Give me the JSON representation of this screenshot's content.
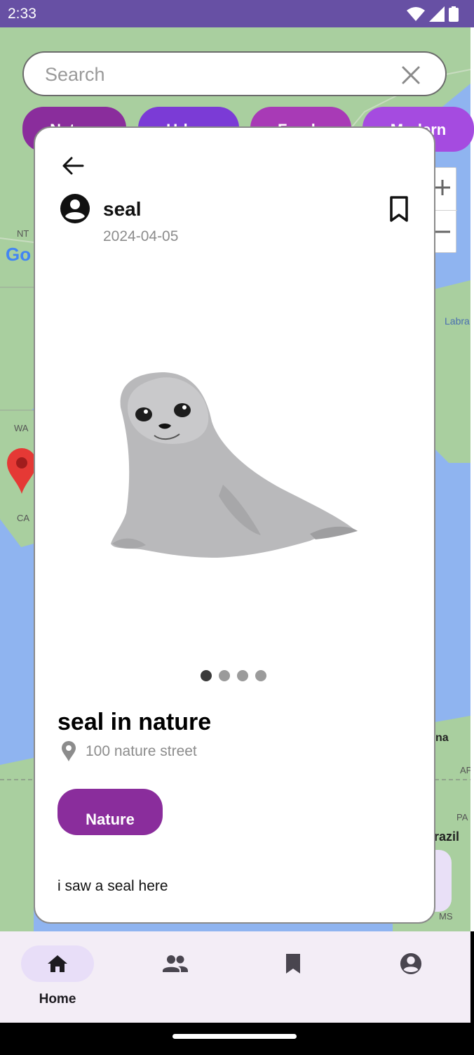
{
  "status_bar": {
    "time": "2:33"
  },
  "search": {
    "placeholder": "Search",
    "value": ""
  },
  "chips": [
    {
      "label": "Nature",
      "color": "#8a2d9c"
    },
    {
      "label": "Urban",
      "color": "#7b3bd6"
    },
    {
      "label": "Foods",
      "color": "#a83ab6"
    },
    {
      "label": "Modern",
      "color": "#a54be0"
    }
  ],
  "map": {
    "labels": [
      "NT",
      "WA",
      "CA",
      "Labra",
      "na",
      "AP",
      "PA",
      "razil",
      "MS"
    ],
    "google_logo": "Go"
  },
  "post": {
    "user_name": "seal",
    "date": "2024-04-05",
    "title": "seal in nature",
    "address": "100 nature street",
    "tag": "Nature",
    "description": "i saw a seal here",
    "image_count": 4,
    "active_image_index": 0
  },
  "bottom_nav": {
    "items": [
      {
        "label": "Home",
        "icon": "home-icon",
        "active": true
      },
      {
        "label": "",
        "icon": "group-icon",
        "active": false
      },
      {
        "label": "",
        "icon": "bookmark-icon",
        "active": false
      },
      {
        "label": "",
        "icon": "account-icon",
        "active": false
      }
    ]
  },
  "colors": {
    "status_bar": "#6750A4",
    "accent": "#8a2d9c",
    "nav_background": "#f3edf6",
    "nav_active_pill": "#e8def8"
  }
}
